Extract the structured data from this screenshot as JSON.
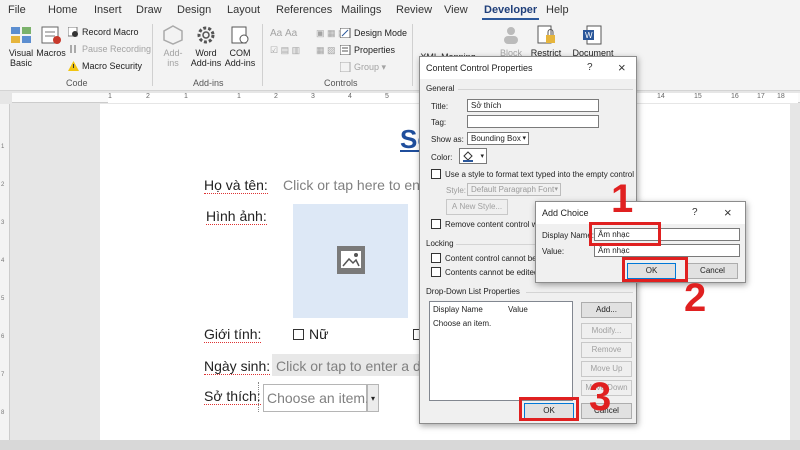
{
  "ribbon": {
    "tabs": [
      "File",
      "Home",
      "Insert",
      "Draw",
      "Design",
      "Layout",
      "References",
      "Mailings",
      "Review",
      "View",
      "Developer",
      "Help"
    ],
    "active_tab": "Developer",
    "code": {
      "visual_basic": "Visual\nBasic",
      "macros": "Macros",
      "record_macro": "Record Macro",
      "pause_recording": "Pause Recording",
      "macro_security": "Macro Security",
      "group_label": "Code"
    },
    "addins": {
      "add_ins": "Add-\nins",
      "word_addins": "Word\nAdd-ins",
      "com_addins": "COM\nAdd-ins",
      "group_label": "Add-ins"
    },
    "controls": {
      "design_mode": "Design Mode",
      "properties": "Properties",
      "group": "Group",
      "group_label": "Controls"
    },
    "mapping": {
      "xml_mapping": "XML Mapping",
      "block": "Block",
      "restrict": "Restrict",
      "document": "Document"
    }
  },
  "ruler": {
    "numbers": [
      "1",
      "2",
      "1",
      "1",
      "2",
      "3",
      "4",
      "5",
      "6",
      "7",
      "8",
      "9",
      "10",
      "11",
      "12",
      "13",
      "14",
      "15",
      "16",
      "17",
      "18"
    ],
    "vnumbers": [
      "1",
      "1",
      "2",
      "3",
      "4",
      "5",
      "6",
      "7",
      "8",
      "9"
    ]
  },
  "document": {
    "title_partial": "Sở",
    "ho_va_ten_label": "Họ và tên:",
    "ho_va_ten_placeholder": "Click or tap here to ent",
    "hinh_anh_label": "Hình ảnh:",
    "gioi_tinh_label": "Giới tính:",
    "nu_option": "Nữ",
    "ngay_sinh_label": "Ngày sinh:",
    "ngay_sinh_placeholder": "Click or tap to enter a d",
    "so_thich_label": "Sở thích:",
    "so_thich_placeholder": "Choose an item."
  },
  "cc_dialog": {
    "title": "Content Control Properties",
    "help": "?",
    "close": "×",
    "general_label": "General",
    "title_label": "Title:",
    "title_value": "Sở thích",
    "tag_label": "Tag:",
    "tag_value": "",
    "show_as_label": "Show as:",
    "show_as_value": "Bounding Box",
    "color_label": "Color:",
    "use_style_label": "Use a style to format text typed into the empty control",
    "style_label": "Style:",
    "style_value": "Default Paragraph Font",
    "new_style_button": "New Style...",
    "remove_cc_label": "Remove content control wh",
    "locking_label": "Locking",
    "lock_delete_label": "Content control cannot be d",
    "lock_edit_label": "Contents cannot be edited",
    "ddl_props_label": "Drop-Down List Properties",
    "col_display_name": "Display Name",
    "col_value": "Value",
    "list_item": "Choose an item.",
    "add_button": "Add...",
    "modify_button": "Modify...",
    "remove_button": "Remove",
    "move_up_button": "Move Up",
    "move_down_button": "Move Down",
    "ok_button": "OK",
    "cancel_button": "Cancel"
  },
  "add_choice": {
    "title": "Add Choice",
    "help": "?",
    "close": "×",
    "display_name_label": "Display Name:",
    "display_name_value": "Âm nhạc",
    "value_label": "Value:",
    "value_value": "Âm nhạc",
    "ok_button": "OK",
    "cancel_button": "Cancel"
  },
  "annotations": {
    "step1": "1",
    "step2": "2",
    "step3": "3",
    "color": "#e02020"
  },
  "colors": {
    "accent": "#2b579a",
    "annotation_red": "#e02020",
    "dialog_bg": "#f0f0f0",
    "picture_placeholder": "#dde8f6"
  }
}
